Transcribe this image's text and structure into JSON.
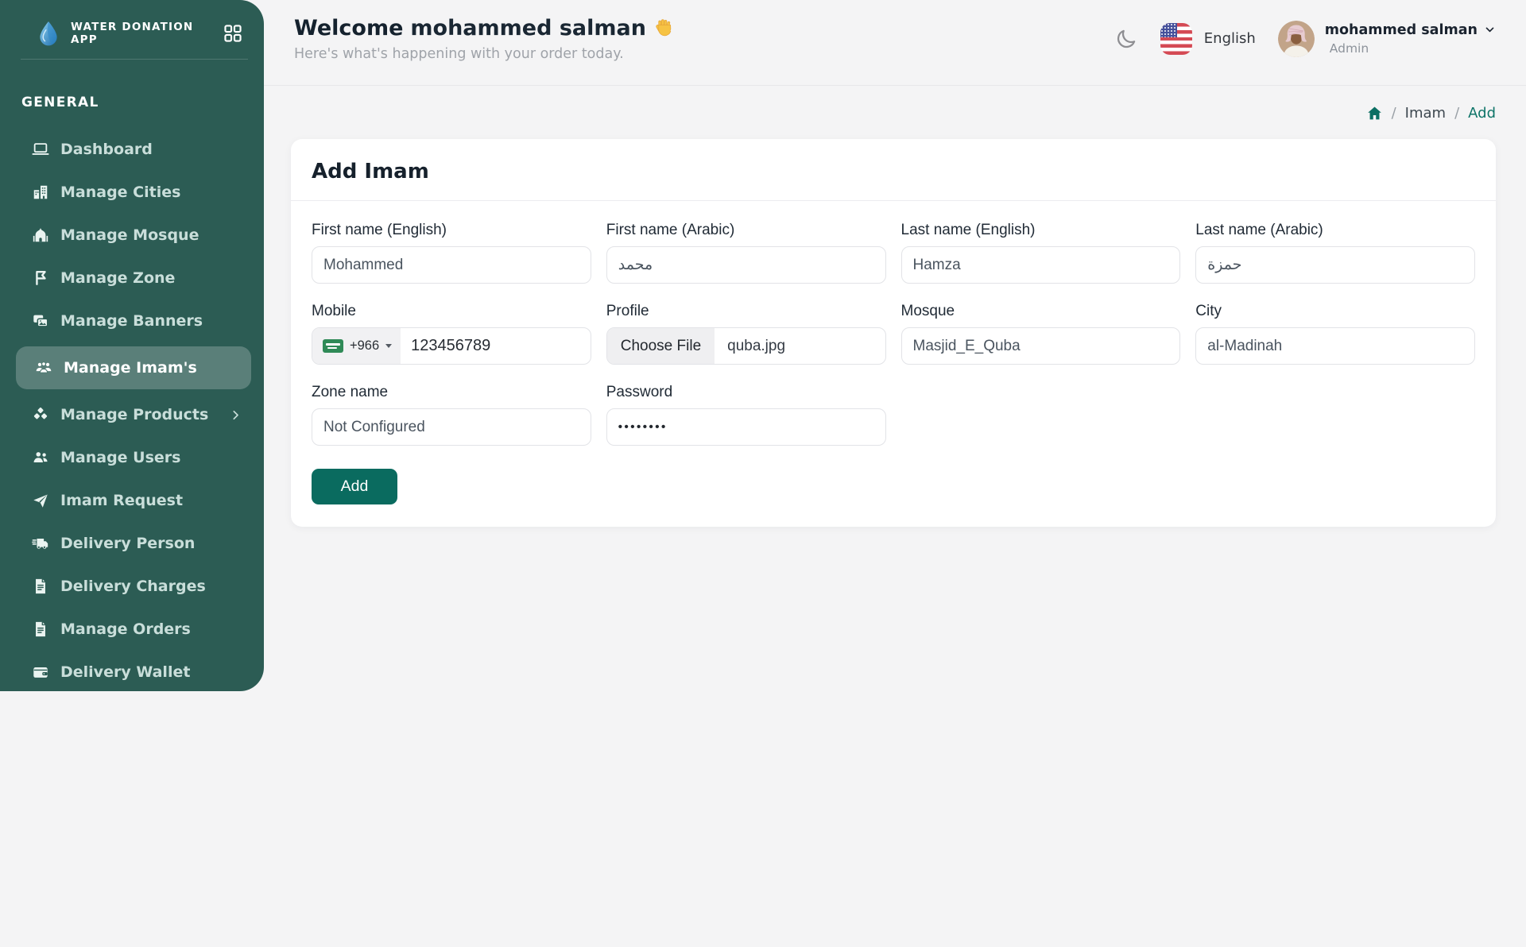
{
  "colors": {
    "sidebar": "#2C5C54",
    "accent": "#0A6B5F",
    "breadcrumb_active": "#0E7468"
  },
  "app": {
    "title": "WATER DONATION APP"
  },
  "sidebar": {
    "section": "GENERAL",
    "items": [
      {
        "label": "Dashboard",
        "icon": "laptop-icon"
      },
      {
        "label": "Manage Cities",
        "icon": "city-icon"
      },
      {
        "label": "Manage Mosque",
        "icon": "mosque-icon"
      },
      {
        "label": "Manage Zone",
        "icon": "zone-icon"
      },
      {
        "label": "Manage Banners",
        "icon": "banner-icon"
      },
      {
        "label": "Manage Imam's",
        "icon": "imams-icon",
        "active": true
      },
      {
        "label": "Manage Products",
        "icon": "products-icon",
        "has_submenu": true
      },
      {
        "label": "Manage Users",
        "icon": "users-icon"
      },
      {
        "label": "Imam Request",
        "icon": "paper-plane-icon"
      },
      {
        "label": "Delivery Person",
        "icon": "truck-icon"
      },
      {
        "label": "Delivery Charges",
        "icon": "charges-icon"
      },
      {
        "label": "Manage Orders",
        "icon": "orders-icon"
      },
      {
        "label": "Delivery Wallet",
        "icon": "wallet-icon"
      }
    ]
  },
  "header": {
    "greeting": "Welcome",
    "user_name": "mohammed salman",
    "subtitle": "Here's what's happening with your order today.",
    "language": "English",
    "profile_name": "mohammed salman",
    "profile_role": "Admin"
  },
  "breadcrumb": {
    "separator": "/",
    "items": [
      "Imam",
      "Add"
    ]
  },
  "form": {
    "title": "Add Imam",
    "submit_label": "Add",
    "fields": {
      "first_name_en": {
        "label": "First name (English)",
        "value": "Mohammed"
      },
      "first_name_ar": {
        "label": "First name (Arabic)",
        "value": "محمد"
      },
      "last_name_en": {
        "label": "Last name (English)",
        "value": "Hamza"
      },
      "last_name_ar": {
        "label": "Last name (Arabic)",
        "value": "حمزة"
      },
      "mobile": {
        "label": "Mobile",
        "dial_code": "+966",
        "value": "123456789"
      },
      "profile": {
        "label": "Profile",
        "button": "Choose File",
        "file_name": "quba.jpg"
      },
      "mosque": {
        "label": "Mosque",
        "value": "Masjid_E_Quba"
      },
      "city": {
        "label": "City",
        "value": "al-Madinah"
      },
      "zone": {
        "label": "Zone name",
        "value": "Not Configured"
      },
      "password": {
        "label": "Password",
        "value": "••••••••"
      }
    }
  }
}
